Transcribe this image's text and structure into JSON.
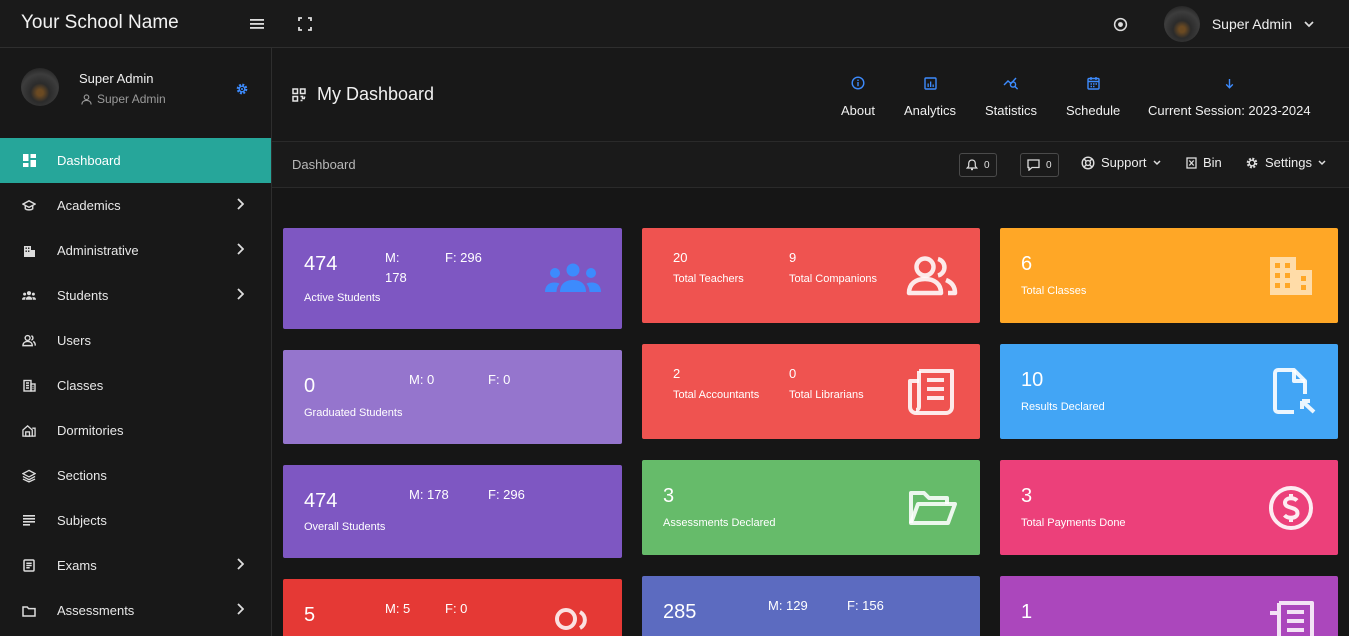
{
  "topbar": {
    "brand": "Your School Name",
    "user_name": "Super Admin"
  },
  "sidebar": {
    "profile_name": "Super Admin",
    "profile_role": "Super Admin",
    "items": [
      {
        "label": "Dashboard",
        "icon": "dashboard-icon",
        "active": true
      },
      {
        "label": "Academics",
        "icon": "graduation-cap-icon",
        "chevron": true
      },
      {
        "label": "Administrative",
        "icon": "building-icon",
        "chevron": true
      },
      {
        "label": "Students",
        "icon": "students-icon",
        "chevron": true
      },
      {
        "label": "Users",
        "icon": "users-icon"
      },
      {
        "label": "Classes",
        "icon": "classes-icon"
      },
      {
        "label": "Dormitories",
        "icon": "dormitories-icon"
      },
      {
        "label": "Sections",
        "icon": "layers-icon"
      },
      {
        "label": "Subjects",
        "icon": "subjects-icon"
      },
      {
        "label": "Exams",
        "icon": "exams-icon",
        "chevron": true
      },
      {
        "label": "Assessments",
        "icon": "folder-icon",
        "chevron": true
      }
    ]
  },
  "header": {
    "title": "My Dashboard",
    "nav": [
      {
        "label": "About",
        "icon": "info-icon"
      },
      {
        "label": "Analytics",
        "icon": "analytics-icon"
      },
      {
        "label": "Statistics",
        "icon": "statistics-icon"
      },
      {
        "label": "Schedule",
        "icon": "calendar-icon"
      },
      {
        "label": "Current Session: 2023-2024",
        "icon": "arrow-down-icon"
      }
    ]
  },
  "breadcrumb": {
    "label": "Dashboard",
    "notifications_count": "0",
    "messages_count": "0",
    "support_label": "Support",
    "bin_label": "Bin",
    "settings_label": "Settings"
  },
  "colors": {
    "accent": "#26a69a",
    "icon_blue": "#3d8bfd",
    "purple": "#7e57c2",
    "light_purple": "#9575cd",
    "red": "#ef5350",
    "dark_red": "#e53935",
    "orange": "#ffa726",
    "blue": "#42a5f5",
    "green": "#66bb6a",
    "pink": "#ec407a",
    "indigo": "#5c6bc0",
    "violet": "#ab47bc"
  },
  "cards": {
    "active": {
      "value": "474",
      "label": "Active Students",
      "m_prefix": "M:",
      "m_value": "178",
      "f_text": "F: 296"
    },
    "graduated": {
      "value": "0",
      "label": "Graduated Students",
      "m_text": "M: 0",
      "f_text": "F: 0"
    },
    "overall": {
      "value": "474",
      "label": "Overall Students",
      "m_text": "M: 178",
      "f_text": "F: 296"
    },
    "row4a": {
      "value": "5",
      "m_text": "M: 5",
      "f_text": "F: 0"
    },
    "teachers": {
      "value1": "20",
      "label1": "Total Teachers",
      "value2": "9",
      "label2": "Total Companions"
    },
    "accountants": {
      "value1": "2",
      "label1": "Total Accountants",
      "value2": "0",
      "label2": "Total Librarians"
    },
    "assessments": {
      "value": "3",
      "label": "Assessments Declared"
    },
    "row4b": {
      "value": "285",
      "m_text": "M: 129",
      "f_text": "F: 156"
    },
    "classes": {
      "value": "6",
      "label": "Total Classes"
    },
    "results": {
      "value": "10",
      "label": "Results Declared"
    },
    "payments": {
      "value": "3",
      "label": "Total Payments Done"
    },
    "row4c": {
      "value": "1"
    }
  }
}
